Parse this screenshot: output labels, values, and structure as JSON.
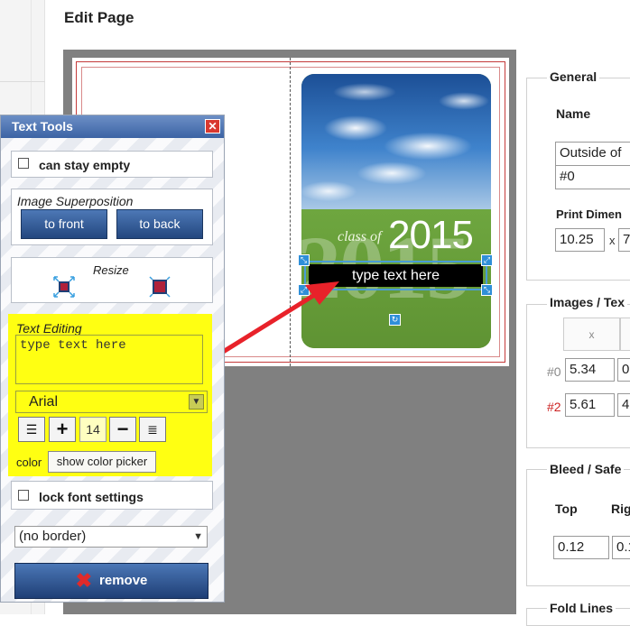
{
  "page": {
    "title": "Edit Page"
  },
  "card": {
    "class_of": "class of",
    "year": "2015",
    "big_year": "2015",
    "textbox_text": "type text here"
  },
  "text_tools": {
    "title": "Text Tools",
    "close_icon": "close-icon",
    "can_stay_empty": {
      "label": "can stay empty",
      "checked": false
    },
    "image_superposition": {
      "label": "Image Superposition",
      "to_front": "to front",
      "to_back": "to back"
    },
    "resize": {
      "label": "Resize"
    },
    "text_editing": {
      "label": "Text Editing",
      "value": "type text here",
      "font": "Arial",
      "font_size": "14",
      "color_label": "color",
      "color_button": "show color picker",
      "highlight_color": "#ffff12"
    },
    "lock_font_settings": {
      "label": "lock font settings",
      "checked": false
    },
    "border_select": {
      "value": "(no border)"
    },
    "remove_button": "remove"
  },
  "general": {
    "legend": "General",
    "name_label": "Name",
    "name_value": "Outside of",
    "number_value": "#0",
    "print_dim_label": "Print Dimen",
    "width_value": "10.25",
    "x_sep": "x",
    "height_value": "7"
  },
  "images_text": {
    "legend": "Images / Tex",
    "col_x": "x",
    "rows": [
      {
        "id": "#0",
        "x": "5.34",
        "y": "0",
        "id_color": "#888888"
      },
      {
        "id": "#2",
        "x": "5.61",
        "y": "4",
        "id_color": "#cc2222"
      }
    ]
  },
  "bleed_safe": {
    "legend": "Bleed / Safe",
    "top_label": "Top",
    "right_label": "Rig",
    "top_value": "0.12",
    "right_value": "0.1"
  },
  "fold_lines": {
    "legend": "Fold Lines"
  },
  "colors": {
    "accent_blue": "#2f8fd8",
    "trim_red": "#c43a3a",
    "arrow_red": "#e8222a"
  }
}
